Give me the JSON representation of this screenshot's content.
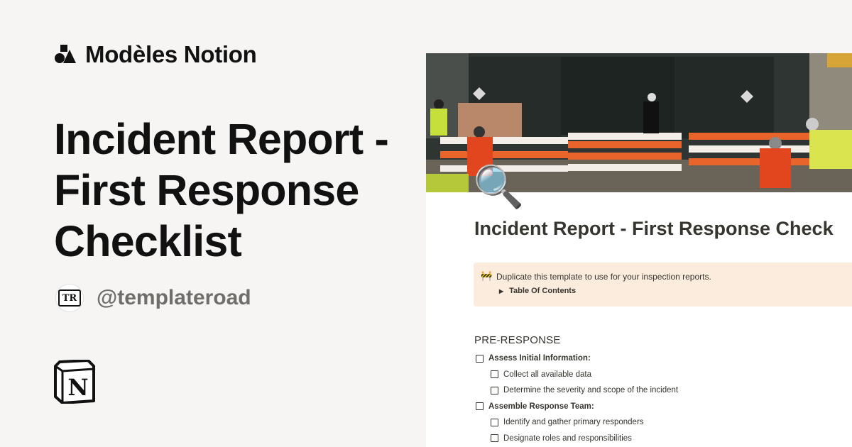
{
  "brand": {
    "name": "Modèles Notion"
  },
  "hero": {
    "title_lines": [
      "Incident Report -",
      "First Response",
      "Checklist"
    ]
  },
  "author": {
    "handle": "@templateroad",
    "avatar_text": "TR"
  },
  "doc": {
    "page_icon": "🔍",
    "title": "Incident Report - First Response Check",
    "callout": {
      "icon": "🚧",
      "text": "Duplicate this template to use for your inspection reports.",
      "toggle_label": "Table Of Contents"
    },
    "section_heading": "PRE-RESPONSE",
    "checklist": [
      {
        "label": "Assess Initial Information:",
        "level": 0,
        "bold": true
      },
      {
        "label": "Collect all available data",
        "level": 1,
        "bold": false
      },
      {
        "label": "Determine the severity and scope of the incident",
        "level": 1,
        "bold": false
      },
      {
        "label": "Assemble Response Team:",
        "level": 0,
        "bold": true
      },
      {
        "label": "Identify and gather primary responders",
        "level": 1,
        "bold": false
      },
      {
        "label": "Designate roles and responsibilities",
        "level": 1,
        "bold": false
      }
    ]
  },
  "icons": {
    "brand": "templates-shapes-icon",
    "notion": "notion-logo-icon",
    "page": "magnifying-glass-icon",
    "callout": "construction-barrier-icon",
    "toggle": "triangle-right-icon",
    "checkbox": "checkbox-icon"
  },
  "colors": {
    "background": "#f6f5f4",
    "callout_bg": "#fbecdd",
    "text_main": "#37352f",
    "handle_gray": "#6f6e6b",
    "barrier_orange": "#e8642a"
  }
}
